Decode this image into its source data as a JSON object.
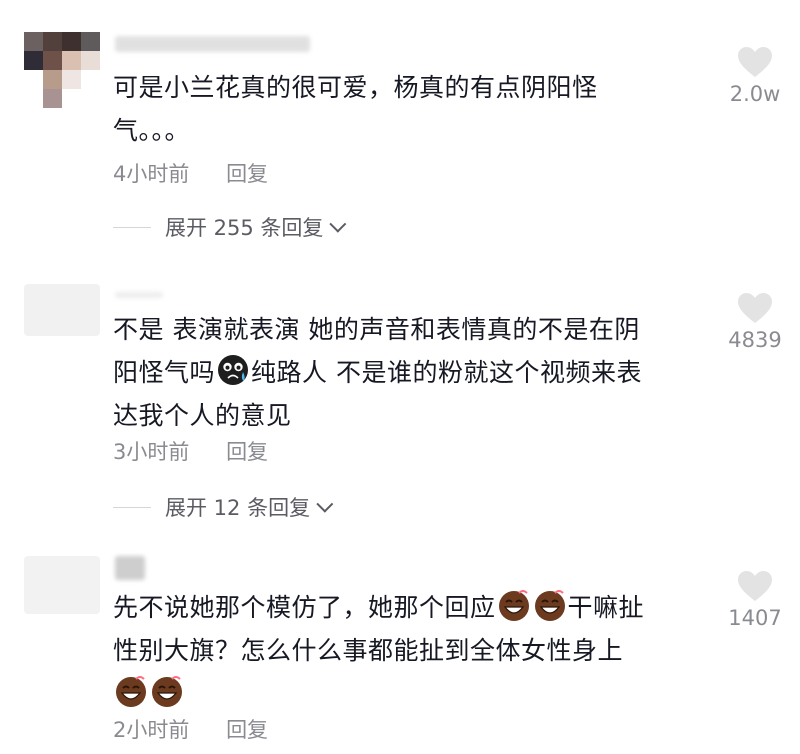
{
  "comments": [
    {
      "text_line1": "可是小兰花真的很可爱，杨真的有点阴阳怪",
      "text_line2": "气。。。",
      "time": "4小时前",
      "reply": "回复",
      "likes": "2.0w",
      "expand": "展开 255 条回复"
    },
    {
      "text_line1": "不是 表演就表演 她的声音和表情真的不是在阴",
      "text_line2a": "阳怪气吗",
      "text_line2b": "纯路人 不是谁的粉就这个视频来表",
      "text_line3": "达我个人的意见",
      "time": "3小时前",
      "reply": "回复",
      "likes": "4839",
      "expand": "展开 12 条回复"
    },
    {
      "text_line1a": "先不说她那个模仿了，她那个回应",
      "text_line1b": "干嘛扯",
      "text_line2": "性别大旗？怎么什么事都能扯到全体女性身上",
      "time": "2小时前",
      "reply": "回复",
      "likes": "1407"
    }
  ],
  "colors": {
    "text": "#161823",
    "meta": "#8a8b91",
    "heart": "#e3e3e3"
  },
  "icons": [
    "heart-icon",
    "chevron-down-icon",
    "crying-emoji-icon",
    "laughing-emoji-icon"
  ]
}
